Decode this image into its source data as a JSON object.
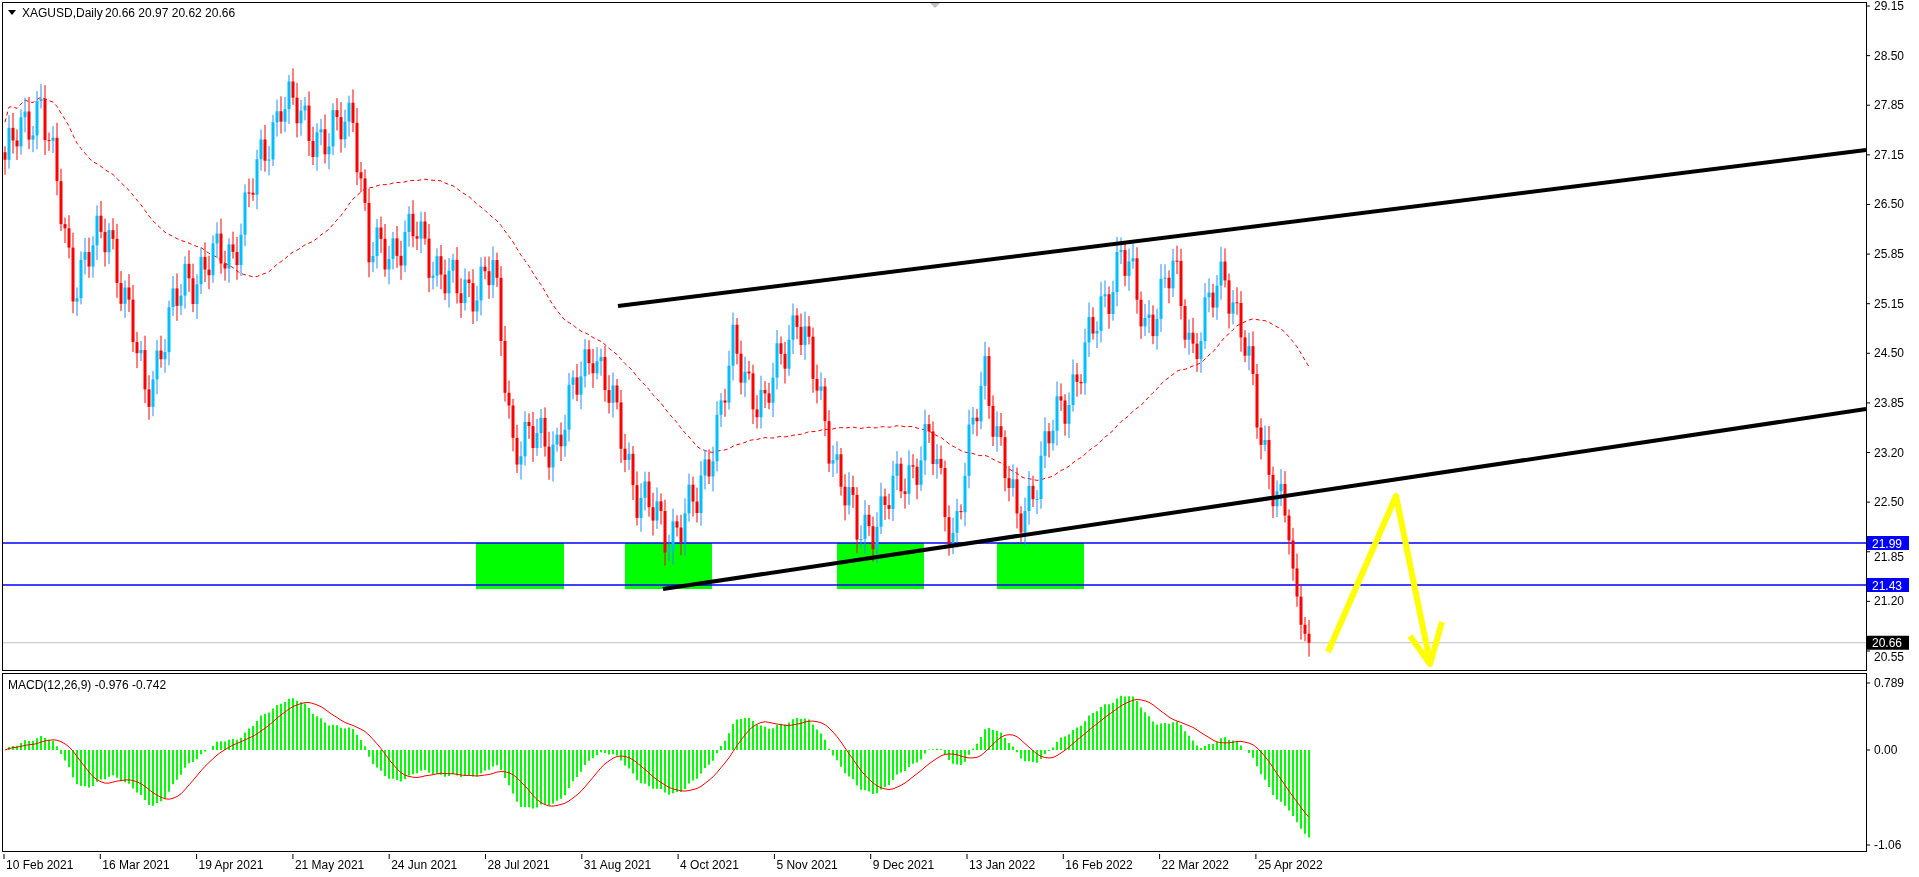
{
  "chart": {
    "title": "XAGUSD,Daily",
    "ohlc": "20.66 20.97 20.62 20.66"
  },
  "price_axis": {
    "ticks": [
      "29.15",
      "28.50",
      "27.85",
      "27.15",
      "26.50",
      "25.85",
      "25.15",
      "24.50",
      "23.85",
      "23.20",
      "22.50",
      "21.85",
      "21.20",
      "20.55"
    ]
  },
  "price_levels": [
    {
      "label": "21.99",
      "kind": "line"
    },
    {
      "label": "21.43",
      "kind": "line"
    },
    {
      "label": "20.66",
      "kind": "bid"
    }
  ],
  "macd": {
    "label": "MACD(12,26,9) -0.976 -0.742",
    "ticks": [
      "0.789",
      "0.00",
      "-1.06"
    ]
  },
  "time_axis": [
    "10 Feb 2021",
    "16 Mar 2021",
    "19 Apr 2021",
    "21 May 2021",
    "24 Jun 2021",
    "28 Jul 2021",
    "31 Aug 2021",
    "4 Oct 2021",
    "5 Nov 2021",
    "9 Dec 2021",
    "13 Jan 2022",
    "16 Feb 2022",
    "22 Mar 2022",
    "25 Apr 2022"
  ]
}
